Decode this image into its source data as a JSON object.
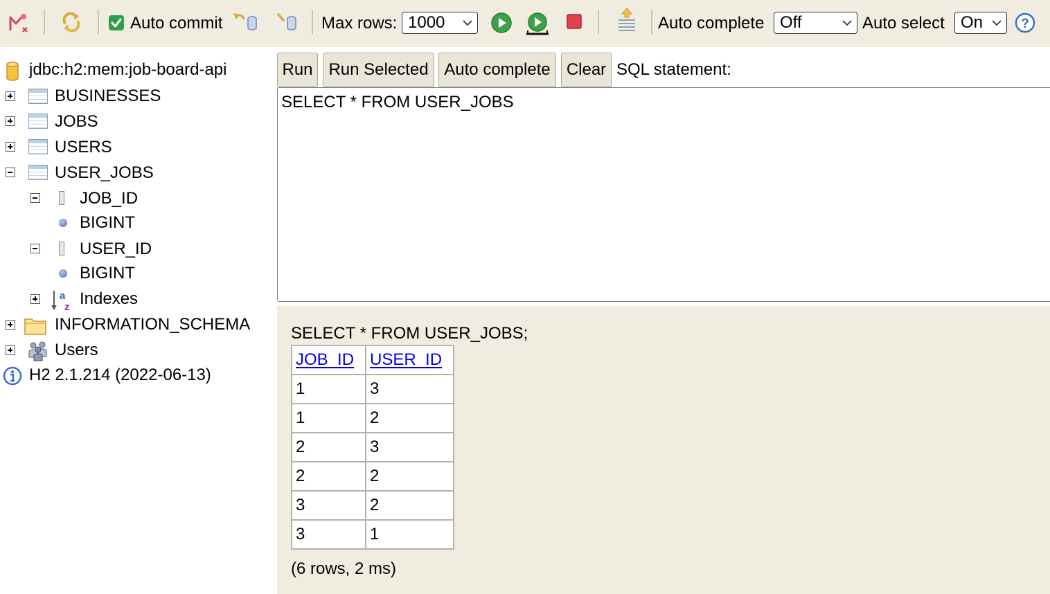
{
  "toolbar": {
    "icons": [
      "disconnect-icon",
      "refresh-icon",
      "rollback-icon",
      "commit-icon",
      "run-icon",
      "run-selected-icon",
      "stop-icon",
      "history-icon",
      "help-icon"
    ],
    "auto_commit_label": "Auto commit",
    "auto_commit_checked": true,
    "max_rows_label": "Max rows:",
    "max_rows_value": "1000",
    "auto_complete_label": "Auto complete",
    "auto_complete_value": "Off",
    "auto_select_label": "Auto select",
    "auto_select_value": "On",
    "accent_color": "#2e9e4c"
  },
  "tree": {
    "connection": "jdbc:h2:mem:job-board-api",
    "tables": [
      {
        "name": "BUSINESSES",
        "expanded": false
      },
      {
        "name": "JOBS",
        "expanded": false
      },
      {
        "name": "USERS",
        "expanded": false
      },
      {
        "name": "USER_JOBS",
        "expanded": true
      }
    ],
    "columns": [
      {
        "name": "JOB_ID",
        "type": "BIGINT"
      },
      {
        "name": "USER_ID",
        "type": "BIGINT"
      }
    ],
    "indexes_label": "Indexes",
    "information_schema": "INFORMATION_SCHEMA",
    "users": "Users",
    "version": "H2 2.1.214 (2022-06-13)"
  },
  "query": {
    "buttons": {
      "run": "Run",
      "run_selected": "Run Selected",
      "auto_complete": "Auto complete",
      "clear": "Clear"
    },
    "sql_label": "SQL statement:",
    "sql_text": "SELECT * FROM USER_JOBS"
  },
  "results": {
    "statement": "SELECT * FROM USER_JOBS;",
    "columns": [
      "JOB_ID",
      "USER_ID"
    ],
    "rows": [
      [
        "1",
        "3"
      ],
      [
        "1",
        "2"
      ],
      [
        "2",
        "3"
      ],
      [
        "2",
        "2"
      ],
      [
        "3",
        "2"
      ],
      [
        "3",
        "1"
      ]
    ],
    "summary": "(6 rows, 2 ms)",
    "header_link_color": "#0000ee"
  }
}
